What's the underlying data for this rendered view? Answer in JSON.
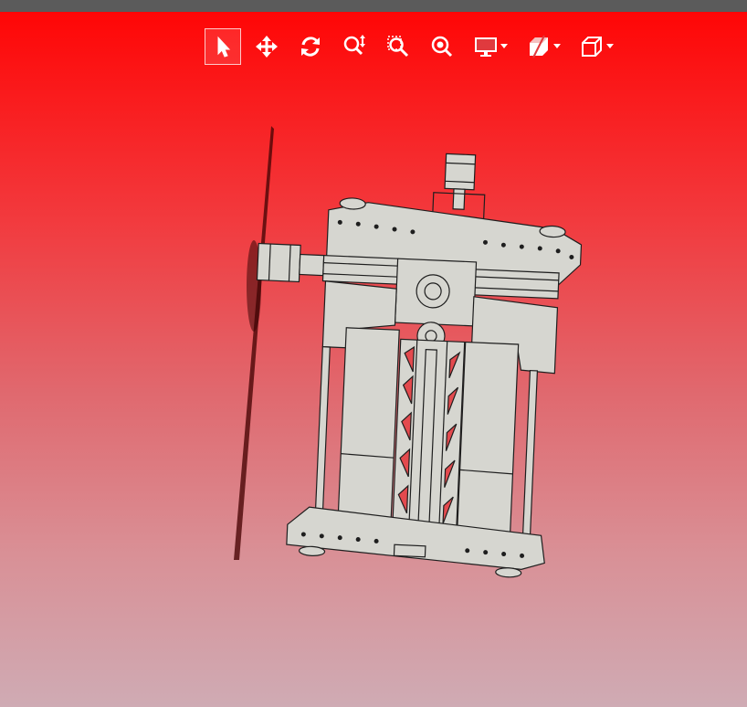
{
  "toolbar": {
    "tools": [
      {
        "id": "select",
        "icon": "select-cursor-icon",
        "active": true
      },
      {
        "id": "pan",
        "icon": "pan-move-icon",
        "active": false
      },
      {
        "id": "rotate",
        "icon": "rotate-icon",
        "active": false
      },
      {
        "id": "zoom",
        "icon": "zoom-icon",
        "active": false
      },
      {
        "id": "zoom-window",
        "icon": "zoom-window-icon",
        "active": false
      },
      {
        "id": "zoom-fit",
        "icon": "zoom-fit-icon",
        "active": false
      },
      {
        "id": "display",
        "icon": "display-monitor-icon",
        "dropdown": true
      },
      {
        "id": "section",
        "icon": "section-view-icon",
        "dropdown": true
      },
      {
        "id": "view-cube",
        "icon": "view-cube-icon",
        "dropdown": true
      }
    ],
    "icon_color": "#ffffff"
  },
  "viewport": {
    "background_top": "#ff0606",
    "background_bottom": "#cfabb4",
    "model_color": "#d6d6d0",
    "model_outline": "#1e1e1e"
  }
}
